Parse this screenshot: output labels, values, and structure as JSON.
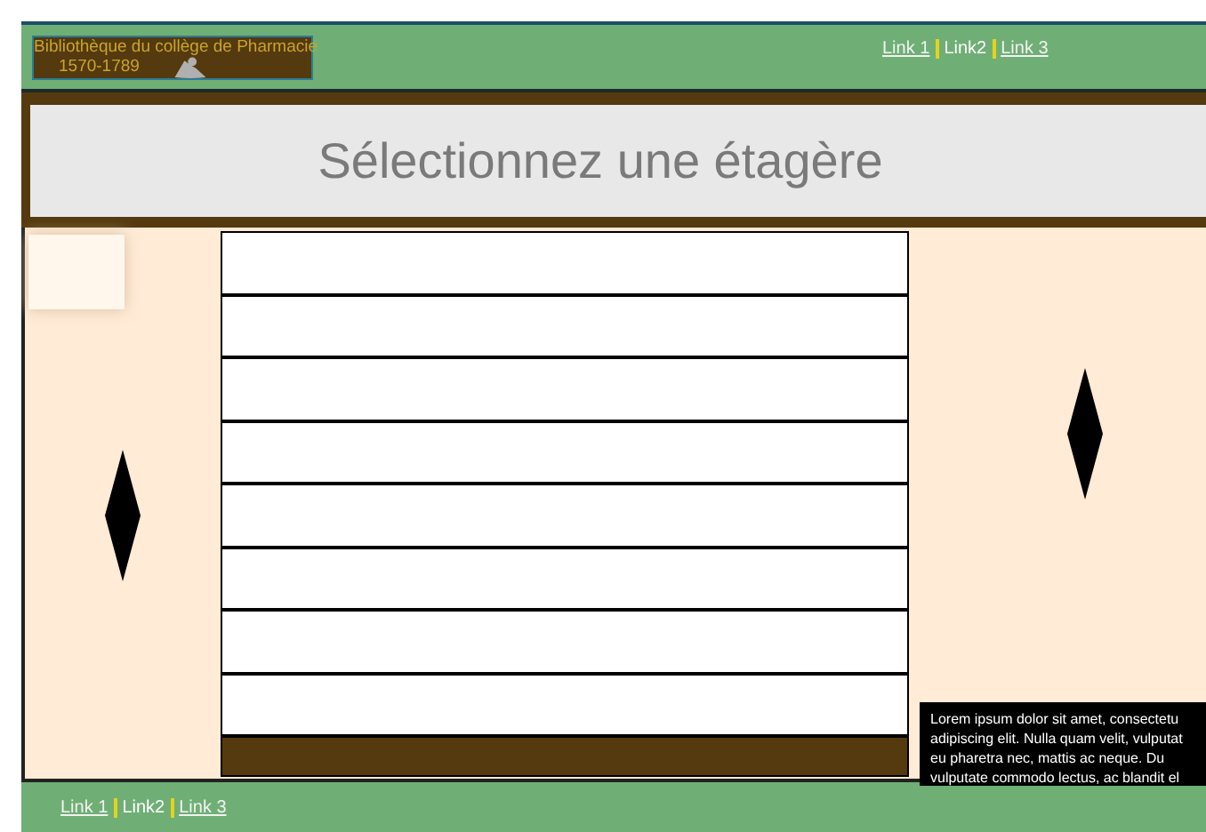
{
  "header": {
    "logo": {
      "title": "Bibliothèque du collège de Pharmacie",
      "dates": "1570-1789"
    },
    "nav": [
      {
        "label": "Link 1",
        "selected": false
      },
      {
        "label": "Link2",
        "selected": true
      },
      {
        "label": "Link 3",
        "selected": false
      }
    ]
  },
  "banner": {
    "title": "Sélectionnez une étagère"
  },
  "info_box": {
    "lines": [
      "Lorem ipsum dolor sit amet, consectetu",
      "adipiscing elit. Nulla quam velit, vulputat",
      "eu pharetra nec, mattis ac neque. Du",
      "vulputate commodo lectus, ac blandit el"
    ]
  },
  "footer": {
    "nav": [
      {
        "label": "Link 1",
        "selected": false
      },
      {
        "label": "Link2",
        "selected": true
      },
      {
        "label": "Link 3",
        "selected": false
      }
    ]
  }
}
